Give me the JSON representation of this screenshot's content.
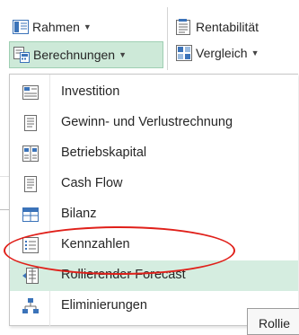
{
  "ribbon": {
    "rahmen_label": "Rahmen",
    "berechnungen_label": "Berechnungen",
    "rentabilitat_label": "Rentabilität",
    "vergleich_label": "Vergleich"
  },
  "menu": {
    "items": [
      {
        "label": "Investition",
        "icon": "investment-icon"
      },
      {
        "label": "Gewinn- und Verlustrechnung",
        "icon": "document-icon"
      },
      {
        "label": "Betriebskapital",
        "icon": "working-capital-icon"
      },
      {
        "label": "Cash Flow",
        "icon": "document-icon"
      },
      {
        "label": "Bilanz",
        "icon": "table-icon"
      },
      {
        "label": "Kennzahlen",
        "icon": "list-icon"
      },
      {
        "label": "Rollierender Forecast",
        "icon": "rolling-forecast-icon"
      },
      {
        "label": "Eliminierungen",
        "icon": "hierarchy-icon"
      }
    ]
  },
  "tooltip": {
    "text": "Rollie"
  },
  "colors": {
    "hover_green": "#cde9d8",
    "active_item": "#d5ede0",
    "annotation_red": "#e0201a",
    "icon_blue": "#3b73b9"
  }
}
